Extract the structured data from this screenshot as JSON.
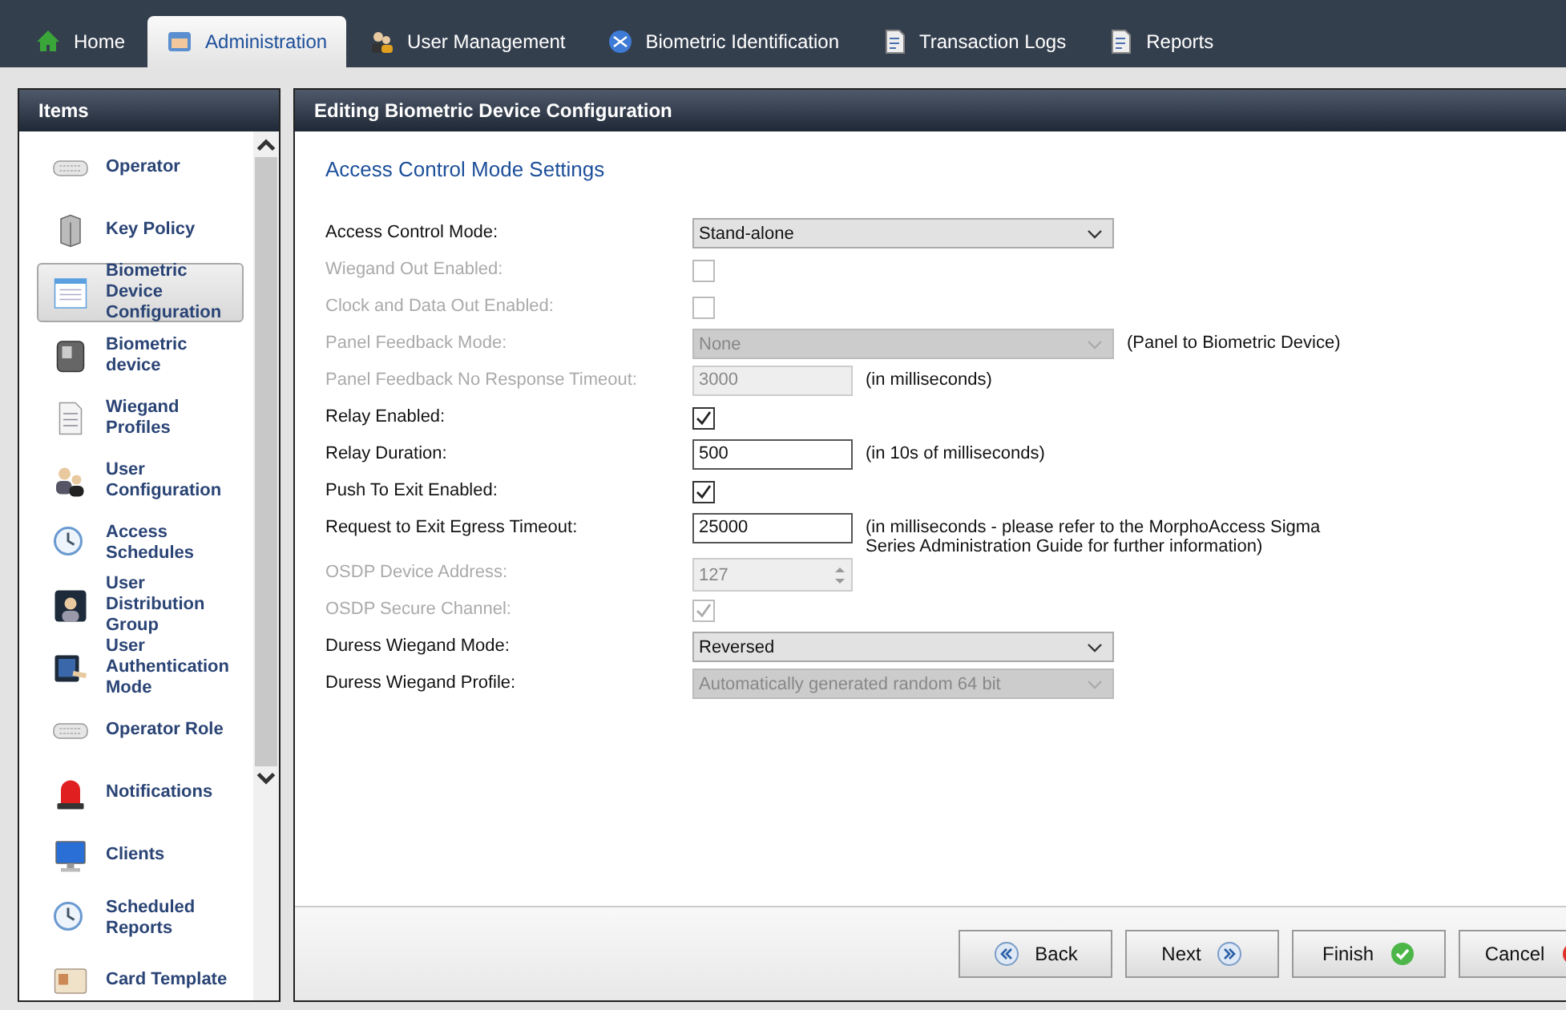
{
  "tabs": [
    {
      "label": "Home",
      "selected": false
    },
    {
      "label": "Administration",
      "selected": true
    },
    {
      "label": "User Management",
      "selected": false
    },
    {
      "label": "Biometric Identification",
      "selected": false
    },
    {
      "label": "Transaction Logs",
      "selected": false
    },
    {
      "label": "Reports",
      "selected": false
    }
  ],
  "sidebar": {
    "title": "Items",
    "items": [
      {
        "label": "Operator",
        "selected": false
      },
      {
        "label": "Key Policy",
        "selected": false
      },
      {
        "label": "Biometric Device Configuration",
        "selected": true
      },
      {
        "label": "Biometric device",
        "selected": false
      },
      {
        "label": "Wiegand Profiles",
        "selected": false
      },
      {
        "label": "User Configuration",
        "selected": false
      },
      {
        "label": "Access Schedules",
        "selected": false
      },
      {
        "label": "User Distribution Group",
        "selected": false
      },
      {
        "label": "User Authentication Mode",
        "selected": false
      },
      {
        "label": "Operator Role",
        "selected": false
      },
      {
        "label": "Notifications",
        "selected": false
      },
      {
        "label": "Clients",
        "selected": false
      },
      {
        "label": "Scheduled Reports",
        "selected": false
      },
      {
        "label": "Card Template",
        "selected": false
      }
    ]
  },
  "panel": {
    "title": "Editing Biometric Device Configuration",
    "section": "Access Control Mode Settings",
    "fields": [
      {
        "kind": "select",
        "label": "Access Control Mode:",
        "value": "Stand-alone",
        "label_disabled": false,
        "disabled": false
      },
      {
        "kind": "checkbox",
        "label": "Wiegand Out Enabled:",
        "checked": false,
        "label_disabled": true,
        "disabled": true
      },
      {
        "kind": "checkbox",
        "label": "Clock and Data Out Enabled:",
        "checked": false,
        "label_disabled": true,
        "disabled": true
      },
      {
        "kind": "select",
        "label": "Panel Feedback Mode:",
        "value": "None",
        "note": "(Panel to Biometric Device)",
        "label_disabled": true,
        "disabled": true
      },
      {
        "kind": "text",
        "label": "Panel Feedback No Response Timeout:",
        "value": "3000",
        "note": "(in milliseconds)",
        "label_disabled": true,
        "disabled": true
      },
      {
        "kind": "checkbox",
        "label": "Relay Enabled:",
        "checked": true,
        "label_disabled": false,
        "disabled": false
      },
      {
        "kind": "text",
        "label": "Relay Duration:",
        "value": "500",
        "note": "(in 10s of milliseconds)",
        "label_disabled": false,
        "disabled": false
      },
      {
        "kind": "checkbox",
        "label": "Push To Exit Enabled:",
        "checked": true,
        "label_disabled": false,
        "disabled": false
      },
      {
        "kind": "text",
        "label": "Request to Exit Egress Timeout:",
        "value": "25000",
        "note": "(in milliseconds - please refer to the MorphoAccess Sigma Series Administration Guide for further information)",
        "label_disabled": false,
        "disabled": false
      },
      {
        "kind": "spinner",
        "label": "OSDP Device Address:",
        "value": "127",
        "label_disabled": true,
        "disabled": true
      },
      {
        "kind": "checkbox",
        "label": "OSDP Secure Channel:",
        "checked": true,
        "label_disabled": true,
        "disabled": true
      },
      {
        "kind": "select",
        "label": "Duress Wiegand Mode:",
        "value": "Reversed",
        "label_disabled": false,
        "disabled": false
      },
      {
        "kind": "select",
        "label": "Duress Wiegand Profile:",
        "value": "Automatically generated random 64 bit",
        "label_disabled": false,
        "disabled": true
      }
    ]
  },
  "buttons": [
    {
      "label": "Back",
      "kind": "back"
    },
    {
      "label": "Next",
      "kind": "next"
    },
    {
      "label": "Finish",
      "kind": "finish"
    },
    {
      "label": "Cancel",
      "kind": "cancel"
    }
  ]
}
